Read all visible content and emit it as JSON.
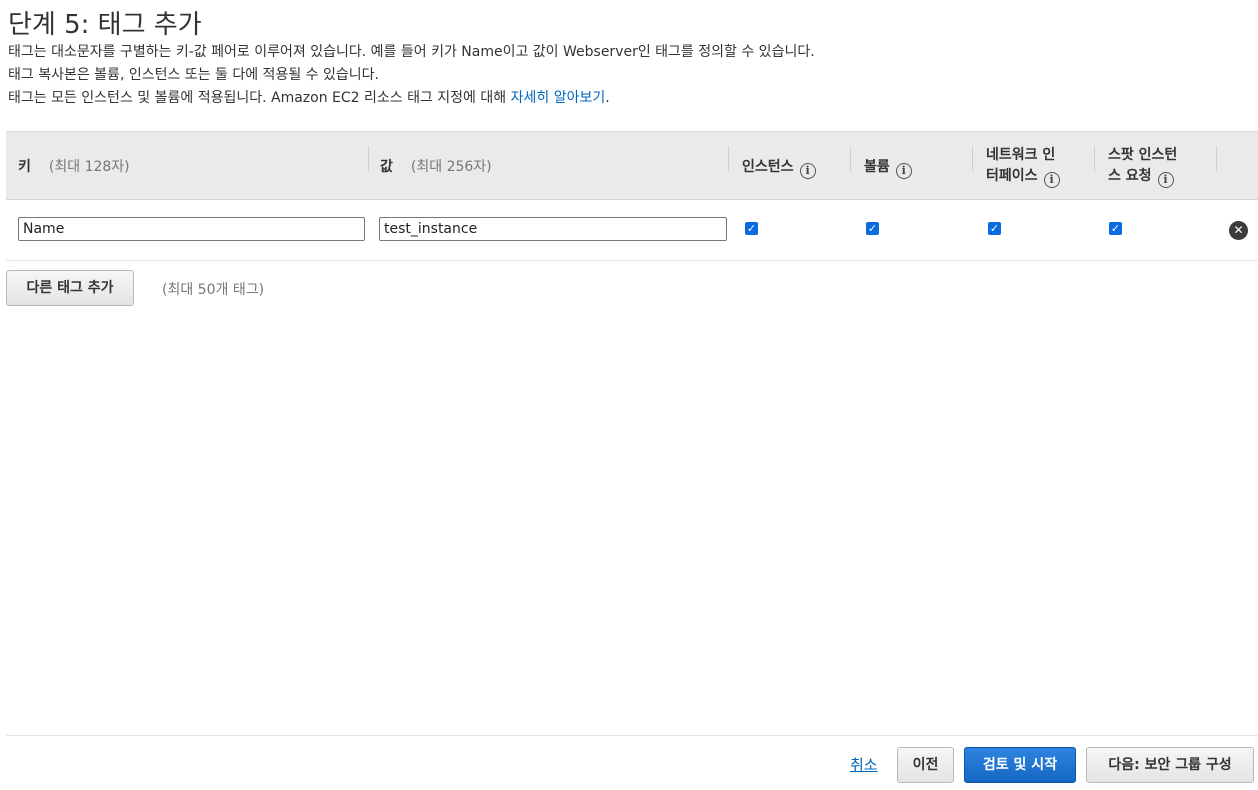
{
  "page": {
    "title": "단계 5: 태그 추가",
    "desc1": "태그는 대소문자를 구별하는 키-값 페어로 이루어져 있습니다. 예를 들어 키가 Name이고 값이 Webserver인 태그를 정의할 수 있습니다.",
    "desc2": "태그 복사본은 볼륨, 인스턴스 또는 둘 다에 적용될 수 있습니다.",
    "desc3_prefix": "태그는 모든 인스턴스 및 볼륨에 적용됩니다. Amazon EC2 리소스 태그 지정에 대해 ",
    "desc3_link": "자세히 알아보기",
    "desc3_suffix": "."
  },
  "table": {
    "headers": {
      "key": "키",
      "key_hint": "(최대 128자)",
      "value": "값",
      "value_hint": "(최대 256자)",
      "instances": "인스턴스",
      "volumes": "볼륨",
      "network_line1": "네트워크 인",
      "network_line2": "터페이스",
      "spot_line1": "스팟 인스턴",
      "spot_line2": "스 요청"
    },
    "info_glyph": "i",
    "rows": [
      {
        "key": "Name",
        "value": "test_instance",
        "instances": true,
        "volumes": true,
        "network_interfaces": true,
        "spot_requests": true
      }
    ],
    "check_glyph": "✓",
    "remove_glyph": "✕"
  },
  "add_tag": {
    "button": "다른 태그 추가",
    "note": "(최대 50개 태그)"
  },
  "footer": {
    "cancel": "취소",
    "previous": "이전",
    "review_launch": "검토 및 시작",
    "next": "다음: 보안 그룹 구성"
  },
  "colors": {
    "accent": "#1566c2",
    "link": "#0066c0",
    "header_bg": "#eaeaea"
  }
}
